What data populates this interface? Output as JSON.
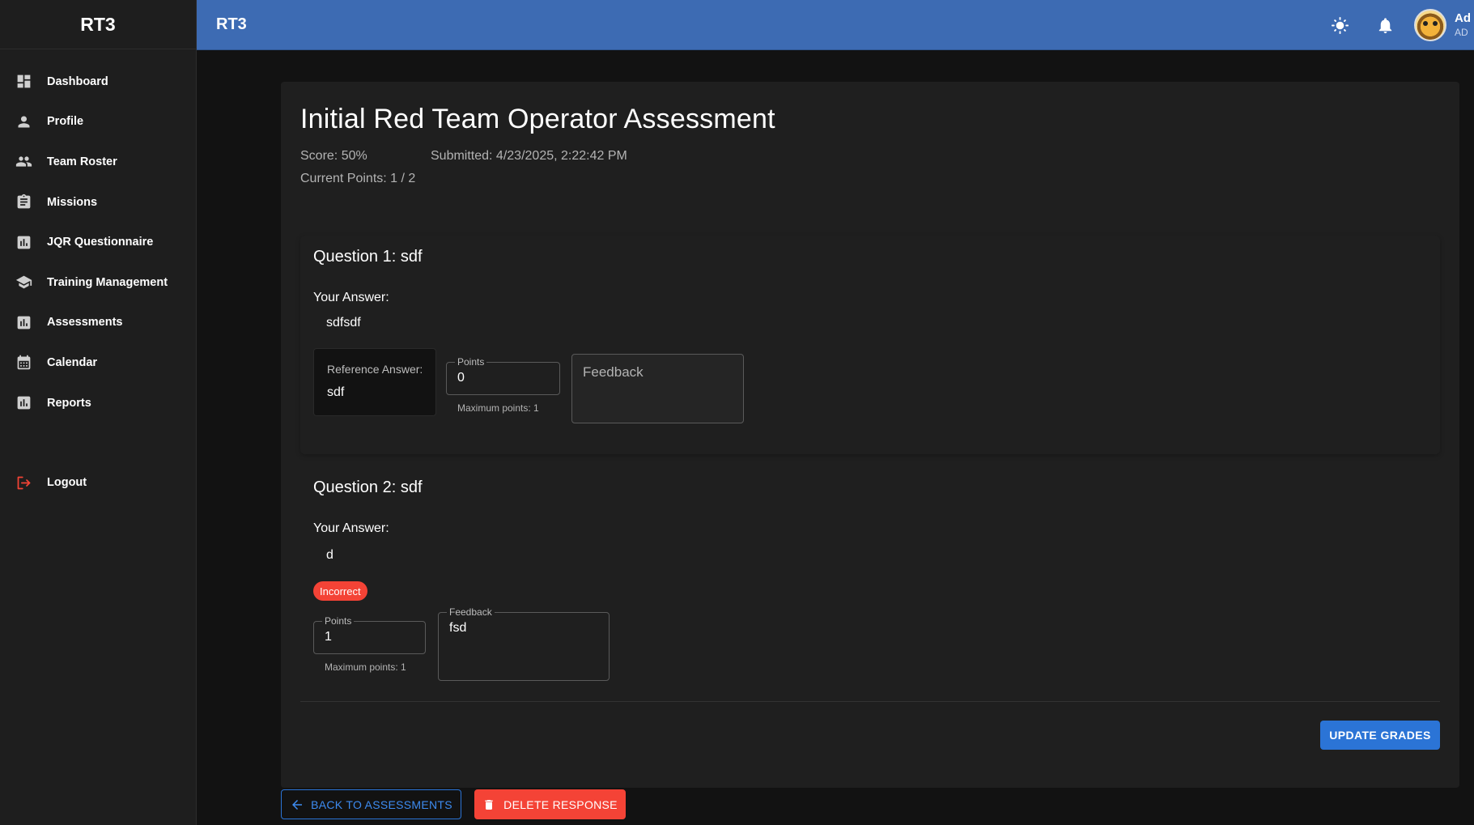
{
  "app": {
    "brand": "RT3",
    "header_title": "RT3"
  },
  "sidebar": {
    "items": [
      {
        "label": "Dashboard",
        "icon": "dashboard-icon"
      },
      {
        "label": "Profile",
        "icon": "person-icon"
      },
      {
        "label": "Team Roster",
        "icon": "people-icon"
      },
      {
        "label": "Missions",
        "icon": "clipboard-icon"
      },
      {
        "label": "JQR Questionnaire",
        "icon": "bar-chart-icon"
      },
      {
        "label": "Training Management",
        "icon": "school-icon"
      },
      {
        "label": "Assessments",
        "icon": "bar-chart-icon"
      },
      {
        "label": "Calendar",
        "icon": "calendar-icon"
      },
      {
        "label": "Reports",
        "icon": "bar-chart-icon"
      }
    ],
    "logout": {
      "label": "Logout",
      "icon": "logout-icon"
    }
  },
  "header": {
    "user_name": "Ad",
    "user_role": "AD",
    "icons": [
      "brightness-icon",
      "notification-bell-icon",
      "avatar"
    ]
  },
  "assessment": {
    "title": "Initial Red Team Operator Assessment",
    "score": "Score: 50%",
    "submitted": "Submitted: 4/23/2025, 2:22:42 PM",
    "current_points": "Current Points: 1 / 2"
  },
  "questions": [
    {
      "title": "Question 1: sdf",
      "your_answer_label": "Your Answer:",
      "answer": "sdfsdf",
      "reference_label": "Reference Answer:",
      "reference_answer": "sdf",
      "points_label": "Points",
      "points_value": "0",
      "max_points": "Maximum points: 1",
      "feedback_placeholder": "Feedback",
      "feedback_value": ""
    },
    {
      "title": "Question 2: sdf",
      "your_answer_label": "Your Answer:",
      "answer": "d",
      "status_badge": "Incorrect",
      "points_label": "Points",
      "points_value": "1",
      "max_points": "Maximum points: 1",
      "feedback_label": "Feedback",
      "feedback_value": "fsd"
    }
  ],
  "actions": {
    "update": "UPDATE GRADES",
    "back": "BACK TO ASSESSMENTS",
    "delete": "DELETE RESPONSE"
  },
  "colors": {
    "header": "#3d6bb3",
    "primary": "#2b74d6",
    "danger": "#f44336",
    "background": "#121212",
    "surface": "#1f1f1f"
  }
}
